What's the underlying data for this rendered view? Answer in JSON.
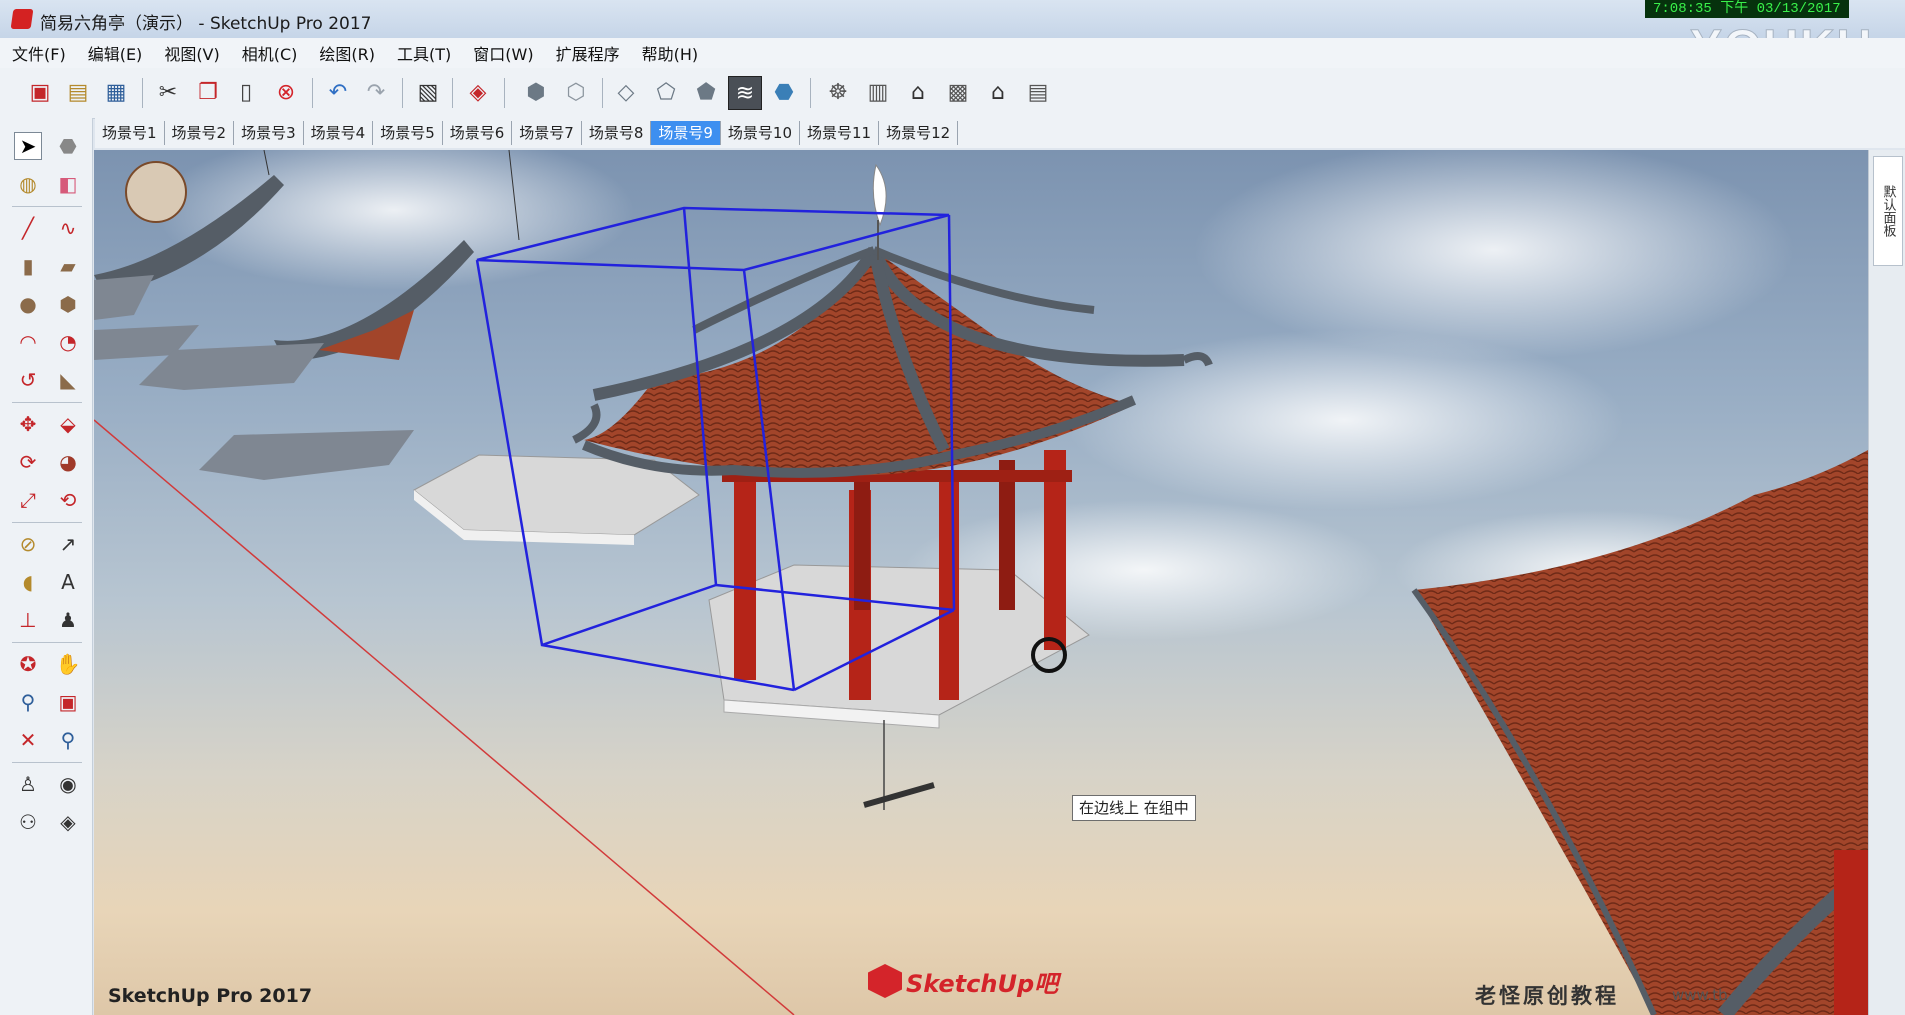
{
  "window": {
    "title": "简易六角亭（演示） - SketchUp Pro 2017",
    "clock": "7:08:35 下午 03/13/2017",
    "watermark": "YOUKU"
  },
  "menu": [
    "文件(F)",
    "编辑(E)",
    "视图(V)",
    "相机(C)",
    "绘图(R)",
    "工具(T)",
    "窗口(W)",
    "扩展程序",
    "帮助(H)"
  ],
  "toolbar_icons": [
    "new-icon",
    "open-icon",
    "save-icon",
    "cut-icon",
    "copy-icon",
    "paste-icon",
    "erase-icon",
    "undo-icon",
    "redo-icon",
    "print-icon",
    "model-info-icon",
    "iso-view-icon",
    "top-view-icon",
    "front-view-icon",
    "right-view-icon",
    "back-view-icon",
    "xray-icon",
    "shaded-icon",
    "textured-icon",
    "monochrome-icon",
    "warehouse-icon",
    "components-icon",
    "house-icon",
    "share-icon",
    "home-icon",
    "extension-icon"
  ],
  "scenes": {
    "tabs": [
      "场景号1",
      "场景号2",
      "场景号3",
      "场景号4",
      "场景号5",
      "场景号6",
      "场景号7",
      "场景号8",
      "场景号9",
      "场景号10",
      "场景号11",
      "场景号12"
    ],
    "active": "场景号9"
  },
  "viewport": {
    "tooltip": "在边线上 在组中",
    "label": "SketchUp Pro 2017"
  },
  "branding": {
    "logo_text": "SketchUp吧",
    "credit": "老怪原创教程",
    "credit_url": "www.tb"
  },
  "tray": {
    "tab_label": "默认面板"
  },
  "colors": {
    "selection": "#2222dd",
    "roof_tile": "#a2452a",
    "roof_trim": "#555d66",
    "pillar": "#b52418",
    "platform": "#d8d8d8",
    "active_tab": "#3d8ff0"
  }
}
